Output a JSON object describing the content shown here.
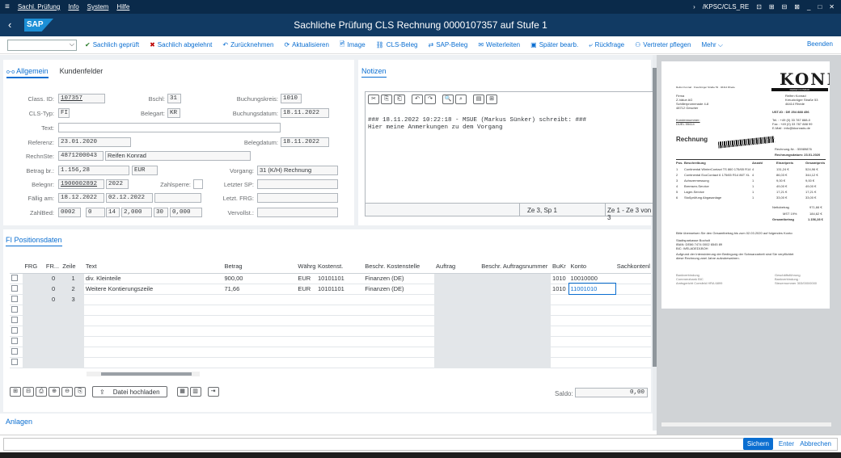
{
  "menubar": {
    "menu": "≡",
    "items": [
      "Sachl. Prüfung",
      "Info",
      "System",
      "Hilfe"
    ],
    "transaction": "/KPSC/CLS_RE",
    "right_icons": [
      "›",
      "⊡",
      "⊞",
      "⊟",
      "⊠",
      "_",
      "□",
      "✕"
    ]
  },
  "title": {
    "back": "‹",
    "logo": "SAP",
    "text": "Sachliche Prüfung CLS Rechnung 0000107357 auf Stufe 1"
  },
  "toolbar": {
    "cmd_arrow": "⌵",
    "buttons": [
      {
        "icon": "✔",
        "label": "Sachlich geprüft",
        "cls": "green"
      },
      {
        "icon": "✖",
        "label": "Sachlich abgelehnt",
        "cls": "red"
      },
      {
        "icon": "↶",
        "label": "Zurücknehmen",
        "cls": ""
      },
      {
        "icon": "⟳",
        "label": "Aktualisieren",
        "cls": ""
      },
      {
        "icon": "🖻",
        "label": "Image",
        "cls": ""
      },
      {
        "icon": "⛓",
        "label": "CLS-Beleg",
        "cls": ""
      },
      {
        "icon": "⇄",
        "label": "SAP-Beleg",
        "cls": ""
      },
      {
        "icon": "✉",
        "label": "Weiterleiten",
        "cls": ""
      },
      {
        "icon": "▣",
        "label": "Später bearb.",
        "cls": ""
      },
      {
        "icon": "⤶",
        "label": "Rückfrage",
        "cls": ""
      },
      {
        "icon": "⚇",
        "label": "Vertreter pflegen",
        "cls": ""
      },
      {
        "icon": "",
        "label": "Mehr ⌵",
        "cls": ""
      }
    ],
    "exit": "Beenden"
  },
  "tabs": {
    "icon": "o-o",
    "general": "Allgemein",
    "customer": "Kundenfelder"
  },
  "form": {
    "class_id_lbl": "Class. ID:",
    "class_id": "107357",
    "bschl_lbl": "Bschl:",
    "bschl": "31",
    "bukrs_lbl": "Buchungskreis:",
    "bukrs": "1010",
    "cls_typ_lbl": "CLS-Typ:",
    "cls_typ": "FI",
    "belegart_lbl": "Belegart:",
    "belegart": "KR",
    "budat_lbl": "Buchungsdatum:",
    "budat": "18.11.2022",
    "text_lbl": "Text:",
    "text": "",
    "ref_lbl": "Referenz:",
    "ref": "23.01.2020",
    "bldat_lbl": "Belegdatum:",
    "bldat": "18.11.2022",
    "rechnste_lbl": "RechnSte:",
    "rechnste": "4871200043",
    "rechnste_name": "Reifen Konrad",
    "betrag_lbl": "Betrag br.:",
    "betrag": "1.156,28",
    "waers": "EUR",
    "vorgang_lbl": "Vorgang:",
    "vorgang": "31 (K/H) Rechnung",
    "belegnr_lbl": "Belegnr:",
    "belegnr": "1900002892",
    "jahr": "2022",
    "zsperre_lbl": "Zahlsperre:",
    "zsperre": "",
    "lsp_lbl": "Letzter SP:",
    "lsp": "",
    "faellig_lbl": "Fällig am:",
    "faellig": "18.12.2022",
    "faellig2": "02.12.2022",
    "faellig3": "",
    "lfrg_lbl": "Letzt. FRG:",
    "lfrg": "",
    "zahlbed_lbl": "ZahlBed:",
    "zb1": "0002",
    "zb2": "0",
    "zb3": "14",
    "zb4": "2,000",
    "zb5": "30",
    "zb6": "0,000",
    "vervollst_lbl": "Vervollst.:",
    "vervollst": ""
  },
  "notes": {
    "title": "Notizen",
    "icons": [
      "✂",
      "⎘",
      "⎗",
      "↶",
      "↷",
      "🔍",
      "⌕",
      "▤",
      "⊞"
    ],
    "line1": "### 18.11.2022 10:22:18  - MSUE (Markus Sünker) schreibt: ###",
    "line2": "Hier meine Anmerkungen zu dem Vorgang",
    "status_pos": "Ze 3, Sp 1",
    "status_range": "Ze 1 - Ze 3 von 3"
  },
  "positions": {
    "title": "FI Positionsdaten",
    "columns": [
      "",
      "FRG",
      "FR...",
      "Zeile",
      "Text",
      "Betrag",
      "Währg",
      "Kostenst.",
      "Beschr. Kostenstelle",
      "Auftrag",
      "Beschr. Auftragsnummer",
      "BuKr",
      "Konto",
      "Sachkontenl"
    ],
    "rows": [
      {
        "frg": "",
        "fr": "0",
        "zeile": "1",
        "text": "div. Kleinteile",
        "betrag": "900,00",
        "waehrg": "EUR",
        "kost": "10101101",
        "bkost": "Finanzen (DE)",
        "auftrag": "",
        "bauftrag": "",
        "bukr": "1010",
        "konto": "10010000",
        "sk": ""
      },
      {
        "frg": "",
        "fr": "0",
        "zeile": "2",
        "text": "Weitere Kontierungszeile",
        "betrag": "71,66",
        "waehrg": "EUR",
        "kost": "10101101",
        "bkost": "Finanzen (DE)",
        "auftrag": "",
        "bauftrag": "",
        "bukr": "1010",
        "konto": "11001010",
        "sk": ""
      },
      {
        "frg": "",
        "fr": "0",
        "zeile": "3",
        "text": "",
        "betrag": "",
        "waehrg": "",
        "kost": "",
        "bkost": "",
        "auftrag": "",
        "bauftrag": "",
        "bukr": "",
        "konto": "",
        "sk": ""
      }
    ],
    "actions": [
      "⊞",
      "⊟",
      "⎙",
      "⊕",
      "⊖",
      "⎘"
    ],
    "upload": "Datei hochladen",
    "upload_icon": "⇪",
    "saldo_lbl": "Saldo:",
    "saldo": "0,00"
  },
  "attachments": {
    "title": "Anlagen"
  },
  "footer": {
    "save": "Sichern",
    "enter": "Enter",
    "cancel": "Abbrechen"
  },
  "document": {
    "brand": "KONRAD",
    "brand_sub": "REIFEN  KONRAD",
    "sender_line": "Reifen Konrad · Kreuzkröger Straße 53 · 46414 Rhede",
    "recipient": [
      "Firma",
      "Z-Value AG",
      "Schillerpromenade 4-8",
      "48712 Gescher"
    ],
    "company": [
      "Reifen Konrad",
      "Kreuzkröger Straße 53",
      "46414 Rhede"
    ],
    "ust": "UST-ID : DE 254 888 456",
    "kunde": "Kundennummer:",
    "kunde_nr": "DUEL 55414",
    "tel": "Tel.   : +49 (0) 33 787 888-0",
    "fax": "Fax    : +49 (0) 33 787 888 99",
    "mail": "E-Mail : info@kkonrads.de",
    "doc_title": "Rechnung",
    "rechnungsnr": "Rechnung-Nr.  : 55989876",
    "rechnungsdatum": "Rechnungsdatum: 23.01.2020",
    "head": [
      "Pos.",
      "Beschreibung",
      "Anzahl",
      "Einzelpreis",
      "Gesamtpreis"
    ],
    "items": [
      [
        "1",
        "Continental WinterContact TS 860 175/65 R14 82 T",
        "4",
        "131,24 €",
        "524,96 €"
      ],
      [
        "2",
        "Continental EcoContact 6 175/65 R14 86T XL Sommerreifen",
        "4",
        "86,03 €",
        "344,12 €"
      ],
      [
        "3",
        "Achsvermessung",
        "1",
        "9,00 €",
        "9,00 €"
      ],
      [
        "4",
        "Bremsen-Service",
        "1",
        "49,00 €",
        "49,00 €"
      ],
      [
        "5",
        "Lager-Service",
        "1",
        "17,21 €",
        "17,21 €"
      ],
      [
        "6",
        "Stoßprüfung Abgasanlage",
        "1",
        "33,00 €",
        "33,00 €"
      ]
    ],
    "netto": "Nettobetrag",
    "netto_v": "971,66 €",
    "mwst": "MST 19%",
    "mwst_v": "184,62 €",
    "gesamt": "Gesamtbetrag",
    "gesamt_v": "1.156,28 €",
    "pay_text": "Bitte überweisen Sie den Gesamtbetrag bis zum 02.03.2020 auf folgendes Konto:",
    "bank": [
      "Stadtsparkasse Bocholt",
      "IBAN: DE86 7474 0002 6545 89",
      "BIC: WELADED1BOH"
    ],
    "note": [
      "Aufgrund der Intensivierung der Bedingung der Schwarzarbeit sind Sie verpflichtet",
      "diese Rechnung zwei Jahre aufzubewahren."
    ],
    "foot_l": [
      "Bankverbindung",
      "Commerzbank BIC",
      "Amtsgericht Coesfeld HRA 6899"
    ],
    "foot_r": [
      "Geschäftsführung",
      "Bankverbindung ·",
      "Steuernummer 303/000/0000"
    ]
  }
}
